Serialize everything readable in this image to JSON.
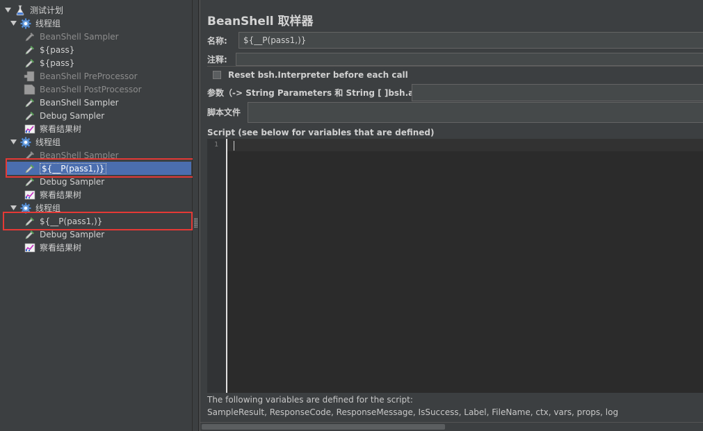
{
  "tree": {
    "root": {
      "label": "测试计划",
      "icon": "flask-icon"
    },
    "items": [
      {
        "label": "线程组",
        "icon": "gear-icon",
        "kind": "group"
      },
      {
        "label": "BeanShell Sampler",
        "icon": "pipette-icon",
        "kind": "item",
        "disabled": true
      },
      {
        "label": "${pass}",
        "icon": "pipette-icon",
        "kind": "item",
        "disabled": false
      },
      {
        "label": "${pass}",
        "icon": "pipette-icon",
        "kind": "item",
        "disabled": false
      },
      {
        "label": "BeanShell PreProcessor",
        "icon": "preprocessor-icon",
        "kind": "item",
        "disabled": true
      },
      {
        "label": "BeanShell PostProcessor",
        "icon": "postprocessor-icon",
        "kind": "item",
        "disabled": true
      },
      {
        "label": "BeanShell Sampler",
        "icon": "pipette-icon",
        "kind": "item",
        "disabled": false
      },
      {
        "label": "Debug Sampler",
        "icon": "pipette-icon",
        "kind": "item",
        "disabled": false
      },
      {
        "label": "察看结果树",
        "icon": "chart-icon",
        "kind": "item",
        "disabled": false
      },
      {
        "label": "线程组",
        "icon": "gear-icon",
        "kind": "group"
      },
      {
        "label": "BeanShell Sampler",
        "icon": "pipette-icon",
        "kind": "item",
        "disabled": true
      },
      {
        "label": "${__P(pass1,)}",
        "icon": "pipette-icon",
        "kind": "item",
        "selected": true
      },
      {
        "label": "Debug Sampler",
        "icon": "pipette-icon",
        "kind": "item",
        "disabled": false
      },
      {
        "label": "察看结果树",
        "icon": "chart-icon",
        "kind": "item",
        "disabled": false
      },
      {
        "label": "线程组",
        "icon": "gear-icon",
        "kind": "group"
      },
      {
        "label": "${__P(pass1,)}",
        "icon": "pipette-icon",
        "kind": "item",
        "disabled": false
      },
      {
        "label": "Debug Sampler",
        "icon": "pipette-icon",
        "kind": "item",
        "disabled": false
      },
      {
        "label": "察看结果树",
        "icon": "chart-icon",
        "kind": "item",
        "disabled": false
      }
    ]
  },
  "panel": {
    "title": "BeanShell 取样器",
    "name_label": "名称:",
    "name_value": "${__P(pass1,)}",
    "comment_label": "注释:",
    "comment_value": "",
    "reset_label": "Reset bsh.Interpreter before each call",
    "params_label": "参数（-> String Parameters 和 String [ ]bsh.args）",
    "params_value": "",
    "script_file_label": "脚本文件",
    "script_file_value": "",
    "script_label": "Script (see below for variables that are defined)",
    "line_number": "1",
    "vars_note": "The following variables are defined for the script:",
    "vars_list": "SampleResult, ResponseCode, ResponseMessage, IsSuccess, Label, FileName, ctx, vars, props, log"
  },
  "colors": {
    "background": "#3c3f41",
    "selection": "#4b6eaf",
    "highlight_box": "#e53935",
    "editor": "#2b2b2b"
  }
}
